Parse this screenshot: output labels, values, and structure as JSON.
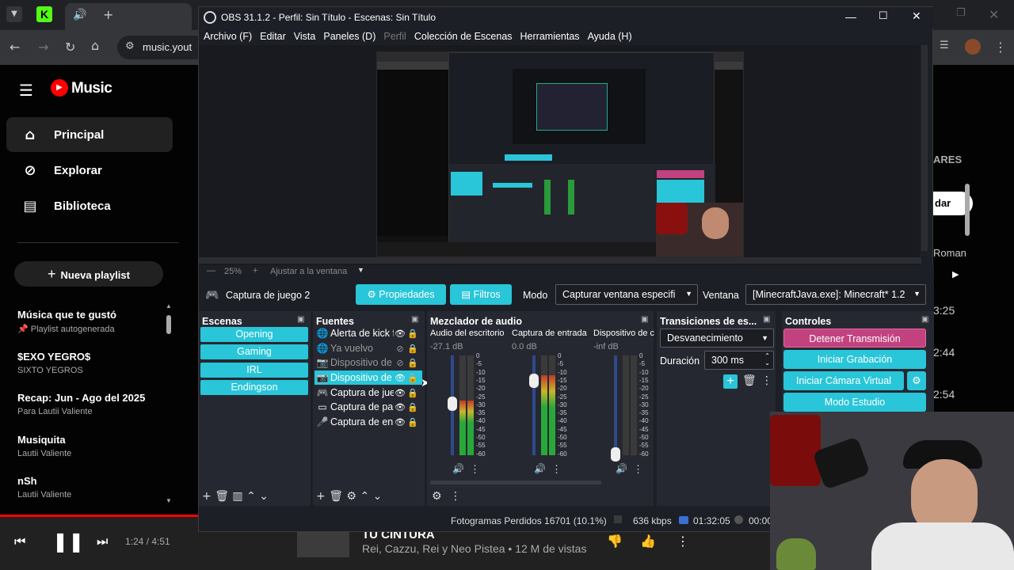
{
  "browser": {
    "url_text": "music.yout",
    "tab_icon_letter": "K"
  },
  "ytmusic": {
    "logo_text": "Music",
    "nav": [
      {
        "label": "Principal",
        "icon": "home-icon"
      },
      {
        "label": "Explorar",
        "icon": "compass-icon"
      },
      {
        "label": "Biblioteca",
        "icon": "library-icon"
      }
    ],
    "new_playlist": "Nueva playlist",
    "playlists": [
      {
        "title": "Música que te gustó",
        "sub": "Playlist autogenerada"
      },
      {
        "title": "$EXO YEGRO$",
        "sub": "SIXTO YEGROS"
      },
      {
        "title": "Recap: Jun - Ago del 2025",
        "sub": "Para Lautii Valiente"
      },
      {
        "title": "Musiquita",
        "sub": "Lautii Valiente"
      },
      {
        "title": "nSh",
        "sub": "Lautii Valiente"
      }
    ],
    "right_header": "ARES",
    "right_button": "dar",
    "right_text": "Roman",
    "durations": [
      "3:25",
      "2:44",
      "2:54"
    ],
    "player": {
      "time": "1:24 / 4:51",
      "song_title": "TU CINTURA",
      "song_sub": "Rei, Cazzu, Rei y Neo Pistea • 12 M de vistas",
      "progress": 0.288
    }
  },
  "obs": {
    "title": "OBS 31.1.2 - Perfil: Sin Título - Escenas: Sin Título",
    "menu": [
      "Archivo (F)",
      "Editar",
      "Vista",
      "Paneles (D)",
      "Perfil",
      "Colección de Escenas",
      "Herramientas",
      "Ayuda (H)"
    ],
    "zoom": "25%",
    "fit_label": "Ajustar a la ventana",
    "source_name": "Captura de juego 2",
    "btn_props": "Propiedades",
    "btn_filters": "Filtros",
    "mode_label": "Modo",
    "mode_value": "Capturar ventana especifi",
    "window_label": "Ventana",
    "window_value": "[MinecraftJava.exe]: Minecraft* 1.2",
    "scenes_title": "Escenas",
    "scenes": [
      "Opening",
      "Gaming",
      "IRL",
      "Endingson"
    ],
    "sources_title": "Fuentes",
    "sources": [
      {
        "name": "Alerta de kick f",
        "icon": "globe-icon",
        "dim": false
      },
      {
        "name": "Ya vuelvo",
        "icon": "globe-icon",
        "dim": true
      },
      {
        "name": "Dispositivo de",
        "icon": "camera-icon",
        "dim": true
      },
      {
        "name": "Dispositivo de",
        "icon": "camera-icon",
        "dim": false,
        "selected": true
      },
      {
        "name": "Captura de jue",
        "icon": "gamepad-icon",
        "dim": false
      },
      {
        "name": "Captura de pa",
        "icon": "monitor-icon",
        "dim": false
      },
      {
        "name": "Captura de en",
        "icon": "mic-icon",
        "dim": false
      }
    ],
    "mixer_title": "Mezclador de audio",
    "mixer": [
      {
        "name": "Audio del escritorio",
        "db": "-27.1 dB",
        "level": 0.55
      },
      {
        "name": "Captura de entrada",
        "db": "0.0 dB",
        "level": 0.8
      },
      {
        "name": "Dispositivo de c",
        "db": "-inf dB",
        "level": 0.0
      }
    ],
    "meter_ticks": [
      "0",
      "-5",
      "-10",
      "-15",
      "-20",
      "-25",
      "-30",
      "-35",
      "-40",
      "-45",
      "-50",
      "-55",
      "-60"
    ],
    "transitions_title": "Transiciones de es...",
    "transition_value": "Desvanecimiento",
    "duration_label": "Duración",
    "duration_value": "300 ms",
    "controls_title": "Controles",
    "controls": [
      "Detener Transmisión",
      "Iniciar Grabación",
      "Iniciar Cámara Virtual",
      "Modo Estudio"
    ],
    "status": {
      "frames_lost": "Fotogramas Perdidos 16701 (10.1%)",
      "bitrate": "636 kbps",
      "stream_time": "01:32:05",
      "rec_time": "00:00"
    }
  },
  "colors": {
    "obs_accent": "#29c5d8",
    "stop_stream": "#c2427f",
    "yt_red": "#ff0000"
  }
}
